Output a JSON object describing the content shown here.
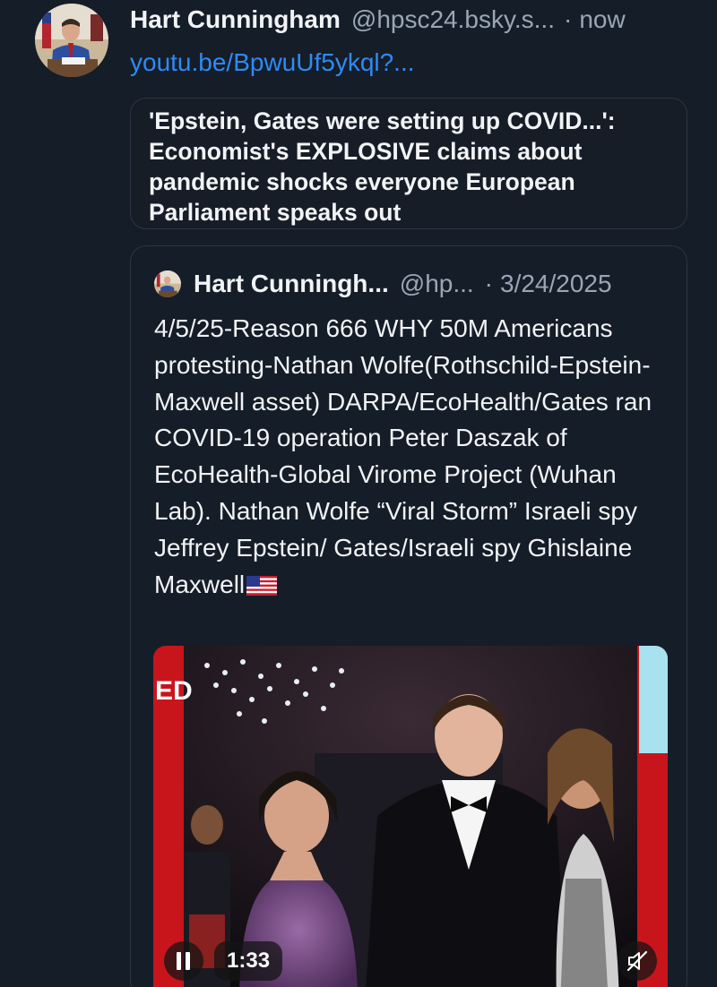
{
  "post": {
    "author": {
      "display_name": "Hart Cunningham",
      "handle": "@hpsc24.bsky.s...",
      "separator": "·",
      "timestamp": "now",
      "avatar_icon": "avatar-photo-man-at-desk"
    },
    "link_text": "youtu.be/BpwuUf5ykql?...",
    "link_card": {
      "title": "'Epstein, Gates were setting up COVID...': Economist's EXPLOSIVE claims about pandemic shocks everyone European Parliament speaks out"
    },
    "quote": {
      "author": {
        "display_name": "Hart Cunningh...",
        "handle": "@hp...",
        "separator": "·",
        "date": "3/24/2025"
      },
      "text": "4/5/25-Reason 666 WHY 50M Americans protesting-Nathan Wolfe(Rothschild-Epstein-Maxwell asset) DARPA/EcoHealth/Gates ran COVID-19 operation Peter Daszak of EcoHealth-Global Virome Project (Wuhan Lab). Nathan Wolfe “Viral Storm” Israeli spy Jeffrey Epstein/ Gates/Israeli spy Ghislaine Maxwell",
      "trailing_emoji": "us-flag-icon",
      "video": {
        "duration": "1:33",
        "play_state_icon": "pause-icon",
        "sound_icon": "muted-speaker-icon",
        "thumbnail": "photo of a man in a black tuxedo and a woman in a sparkly purple dress at an event"
      }
    }
  },
  "colors": {
    "background": "#151d28",
    "link": "#2f8af5",
    "muted_text": "#9aa6b6",
    "border": "#2c3543"
  }
}
